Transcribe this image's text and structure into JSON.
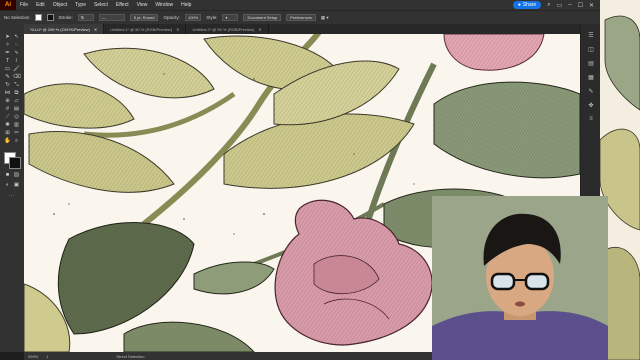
{
  "app": {
    "logo": "Ai"
  },
  "menu": {
    "items": [
      "File",
      "Edit",
      "Object",
      "Type",
      "Select",
      "Effect",
      "View",
      "Window",
      "Help"
    ]
  },
  "share": {
    "label": "Share"
  },
  "controlbar": {
    "selection": "No Selection",
    "stroke_label": "Stroke:",
    "brush_label": "5 pt. Round",
    "opacity_label": "Opacity:",
    "opacity_value": "100%",
    "style_label": "Style:",
    "doc_setup": "Document Setup",
    "preferences": "Preferences"
  },
  "tabs": [
    {
      "label": "*ILLU* @ 299 % (CMYK/Preview)"
    },
    {
      "label": "Untitled-1* @ 50 % (RGB/Preview)"
    },
    {
      "label": "Untitled-2* @ 50 % (RGB/Preview)"
    }
  ],
  "status": {
    "zoom": "299%",
    "page": "1",
    "mode": "Direct Selection"
  },
  "icons": {
    "select": "arrow-icon",
    "direct": "direct-select-icon",
    "pen": "pen-icon",
    "type": "type-icon",
    "brush": "brush-icon",
    "eraser": "eraser-icon",
    "hand": "hand-icon",
    "zoom": "zoom-icon"
  },
  "colors": {
    "accent": "#1473e6",
    "brand": "#ff9a00",
    "leaf": "#c7c58a",
    "leaf_dark": "#6f7c55",
    "rose": "#d99aa9"
  }
}
